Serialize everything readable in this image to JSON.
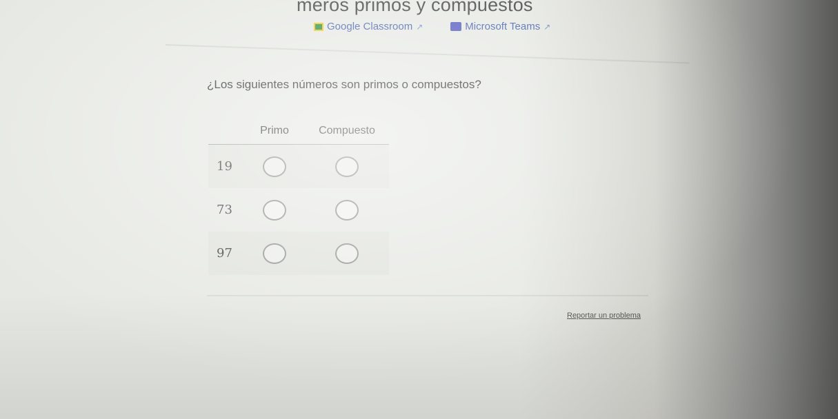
{
  "page": {
    "title": "meros primos y compuestos"
  },
  "links": {
    "classroom_label": "Google Classroom",
    "teams_label": "Microsoft Teams"
  },
  "question": "¿Los siguientes números son primos o compuestos?",
  "grid": {
    "headers": [
      "Primo",
      "Compuesto"
    ],
    "rows": [
      {
        "label": "19",
        "primo_selected": false,
        "compuesto_selected": false
      },
      {
        "label": "73",
        "primo_selected": false,
        "compuesto_selected": false
      },
      {
        "label": "97",
        "primo_selected": false,
        "compuesto_selected": false
      }
    ]
  },
  "footer": {
    "report_label": "Reportar un problema"
  },
  "icons": {
    "classroom": "google-classroom-icon",
    "teams": "microsoft-teams-icon",
    "external": "external-link-icon"
  },
  "colors": {
    "link": "#3a5aa8",
    "background": "#e6e8e3"
  }
}
